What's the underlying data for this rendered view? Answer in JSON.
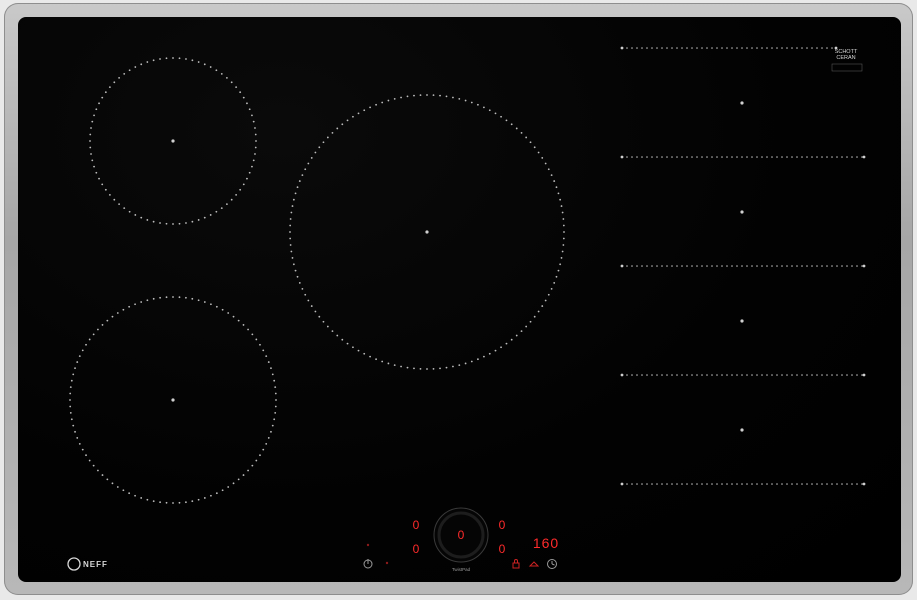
{
  "brand": {
    "logo_text": "NEFF"
  },
  "flex_zone": {
    "label_line1": "SCHOTT",
    "label_line2": "CERAN",
    "line_count": 5
  },
  "controls": {
    "left_digit_top": "0",
    "left_digit_bottom": "0",
    "dial_digit": "0",
    "right_digit_top": "0",
    "right_digit_bottom": "0",
    "timer_display": "160",
    "dial_label": "TwistPad"
  },
  "colors": {
    "display_red": "#ff2b2b",
    "zone_dots": "#bdbdbd",
    "frame": "#b0b0b0"
  },
  "icons": [
    "power-icon",
    "lock-icon",
    "timer-icon",
    "wipe-icon"
  ]
}
